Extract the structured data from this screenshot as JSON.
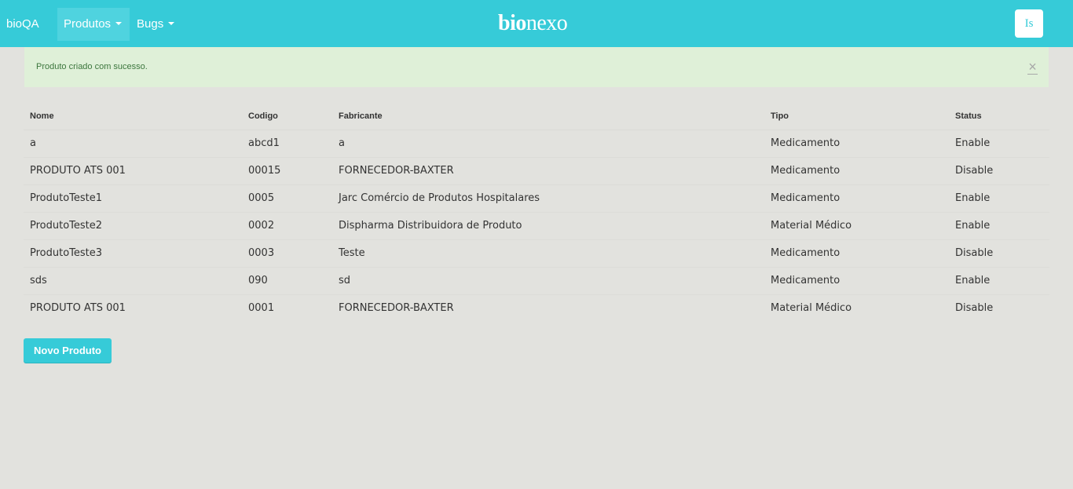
{
  "navbar": {
    "brand": "bioQA",
    "menus": [
      "Produtos",
      "Bugs"
    ],
    "logo_bold": "bio",
    "logo_light": "nexo",
    "user_initials": "Is",
    "colors": {
      "navbar": "#36cbd8",
      "active_item": "#4fd3df"
    }
  },
  "alert": {
    "message": "Produto criado com sucesso.",
    "close": "×",
    "colors": {
      "background": "#dff0d8",
      "text": "#3c763d"
    }
  },
  "table": {
    "headers": [
      "Nome",
      "Codigo",
      "Fabricante",
      "Tipo",
      "Status"
    ],
    "rows": [
      [
        "a",
        "abcd1",
        "a",
        "Medicamento",
        "Enable"
      ],
      [
        "PRODUTO ATS 001",
        "00015",
        "FORNECEDOR-BAXTER",
        "Medicamento",
        "Disable"
      ],
      [
        "ProdutoTeste1",
        "0005",
        "Jarc Comércio de Produtos Hospitalares",
        "Medicamento",
        "Enable"
      ],
      [
        "ProdutoTeste2",
        "0002",
        "Dispharma Distribuidora de Produto",
        "Material Médico",
        "Enable"
      ],
      [
        "ProdutoTeste3",
        "0003",
        "Teste",
        "Medicamento",
        "Disable"
      ],
      [
        "sds",
        "090",
        "sd",
        "Medicamento",
        "Enable"
      ],
      [
        "PRODUTO ATS 001",
        "0001",
        "FORNECEDOR-BAXTER",
        "Material Médico",
        "Disable"
      ]
    ]
  },
  "actions": {
    "new_product": "Novo Produto"
  }
}
